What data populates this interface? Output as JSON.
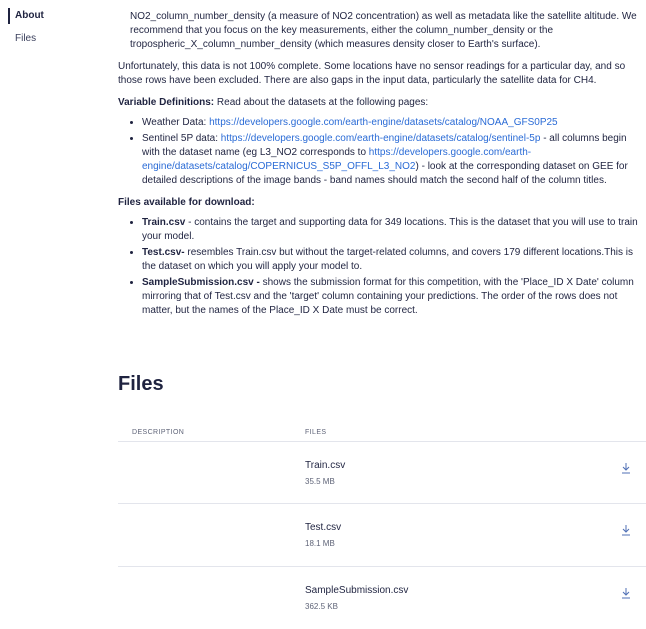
{
  "sidebar": {
    "items": [
      {
        "label": "About"
      },
      {
        "label": "Files"
      }
    ]
  },
  "about": {
    "top_para": "NO2_column_number_density (a measure of NO2 concentration) as well as metadata like the satellite altitude. We recommend that you focus on the key measurements, either the column_number_density or the tropospheric_X_column_number_density (which measures density closer to Earth's surface).",
    "unfortunately": "Unfortunately, this data is not 100% complete. Some locations have no sensor readings for a particular day, and so those rows have been excluded. There are also gaps in the input data, particularly the satellite data for CH4.",
    "vardef_label": "Variable Definitions:",
    "vardef_text": " Read about the datasets at the following pages:",
    "weather_prefix": "Weather Data: ",
    "weather_link": "https://developers.google.com/earth-engine/datasets/catalog/NOAA_GFS0P25",
    "sentinel_prefix": "Sentinel 5P data: ",
    "sentinel_link": "https://developers.google.com/earth-engine/datasets/catalog/sentinel-5p",
    "sentinel_mid": " - all columns begin with the dataset name (eg L3_NO2 corresponds to ",
    "sentinel_link2": "https://developers.google.com/earth-engine/datasets/catalog/COPERNICUS_S5P_OFFL_L3_NO2",
    "sentinel_end": ") - look at the corresponding dataset on GEE for detailed descriptions of the image bands - band names should match the second half of the column titles.",
    "files_avail": "Files available for download:",
    "train_label": "Train.csv",
    "train_text": " - contains the target and supporting data for 349 locations. This is the dataset that you will use to train your model.",
    "test_label": "Test.csv-",
    "test_text": " resembles Train.csv but without the target-related columns, and covers 179 different locations.This is the dataset on which you will apply your model to.",
    "sample_label": "SampleSubmission.csv -",
    "sample_text": " shows the submission format for this competition, with the 'Place_ID X Date' column mirroring that of Test.csv and the 'target' column containing your predictions. The order of the rows does not matter, but the names of the Place_ID X Date must be correct."
  },
  "files": {
    "title": "Files",
    "col_description": "DESCRIPTION",
    "col_files": "FILES",
    "rows": [
      {
        "name": "Train.csv",
        "size": "35.5 MB"
      },
      {
        "name": "Test.csv",
        "size": "18.1 MB"
      },
      {
        "name": "SampleSubmission.csv",
        "size": "362.5 KB"
      }
    ]
  },
  "colors": {
    "text": "#1f2340",
    "link": "#2a6bd6",
    "muted": "#5f6478",
    "divider": "#e3e5ec"
  },
  "icons": {
    "download": "download-icon"
  }
}
